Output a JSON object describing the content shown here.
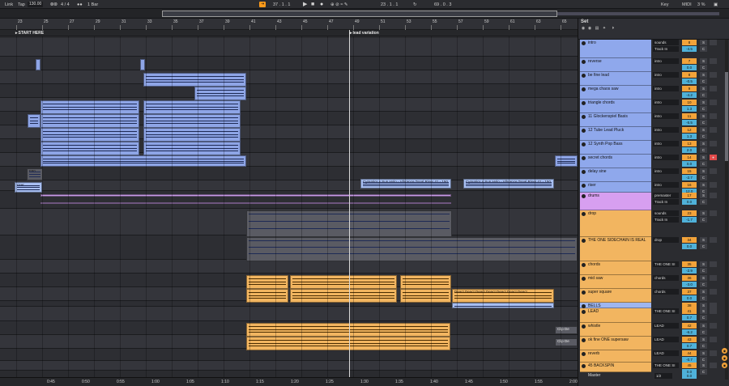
{
  "transport": {
    "link": "Link",
    "tap": "Tap",
    "bpm": "130.00",
    "signature": "4 / 4",
    "metro": "⦾⦾",
    "quantize": "1 Bar",
    "follow": "⇥",
    "position": "37 . 1 . 1",
    "loop_start": "23 . 1 . 1",
    "loop_length": "69 . 0 . 3",
    "key": "Key",
    "midi": "MIDI",
    "cpu": "3 %"
  },
  "ruler": {
    "bars": [
      "23",
      "25",
      "27",
      "29",
      "31",
      "33",
      "35",
      "37",
      "39",
      "41",
      "43",
      "45",
      "47",
      "49",
      "51",
      "53",
      "55",
      "57",
      "59",
      "61",
      "63",
      "65",
      "67"
    ],
    "locators": [
      "START HERE",
      "lead variation"
    ]
  },
  "time": [
    "0:45",
    "0:50",
    "0:55",
    "1:00",
    "1:05",
    "1:10",
    "1:15",
    "1:20",
    "1:25",
    "1:30",
    "1:35",
    "1:40",
    "1:45",
    "1:50",
    "1:55",
    "2:00"
  ],
  "clips": {
    "riser_clip": "riser",
    "f80_clip": "F80 ",
    "cymatics_1": "Cymatics x Sun Holo - Vibrance Tonal Riser 41 - 150",
    "cymatics_2": "Cymatics x Sun Holo - Vibrance Tonal Riser 41 - 150",
    "deactivate_text": "Deact Deact Deact Deact Deact Deact Deact",
    "clip_de_1": "Clip De",
    "clip_de_2": "Clip De"
  },
  "panel": {
    "set": "Set",
    "tracks": [
      {
        "name": "intro",
        "io": "sounds",
        "io2": "Track In",
        "num": "8",
        "vol": "-4.5",
        "s": "S",
        "c": "C",
        "arm": "",
        "color": "#8fa8ec"
      },
      {
        "name": "reverse",
        "io": "intro",
        "io2": "",
        "num": "7",
        "vol": "0.0",
        "s": "S",
        "c": "C",
        "arm": "",
        "color": "#8fa8ec"
      },
      {
        "name": "be fine lead",
        "io": "intro",
        "io2": "",
        "num": "8",
        "vol": "-0.5",
        "s": "S",
        "c": "C",
        "arm": "",
        "color": "#8fa8ec"
      },
      {
        "name": "mega chaos saw",
        "io": "intro",
        "io2": "",
        "num": "9",
        "vol": "-4.2",
        "s": "S",
        "c": "C",
        "arm": "",
        "color": "#8fa8ec"
      },
      {
        "name": "triangle chords",
        "io": "intro",
        "io2": "",
        "num": "10",
        "vol": "1.3",
        "s": "S",
        "c": "C",
        "arm": "",
        "color": "#8fa8ec"
      },
      {
        "name": "11 Glockenspiel Basis",
        "io": "intro",
        "io2": "",
        "num": "11",
        "vol": "-5.5",
        "s": "S",
        "c": "C",
        "arm": "",
        "color": "#8fa8ec"
      },
      {
        "name": "12 Tube Lead Pluck",
        "io": "intro",
        "io2": "",
        "num": "12",
        "vol": "1.3",
        "s": "S",
        "c": "C",
        "arm": "",
        "color": "#8fa8ec"
      },
      {
        "name": "12 Synth Pop Bass",
        "io": "intro",
        "io2": "",
        "num": "13",
        "vol": "2.0",
        "s": "S",
        "c": "C",
        "arm": "",
        "color": "#8fa8ec"
      },
      {
        "name": "secret chords",
        "io": "intro",
        "io2": "",
        "num": "14",
        "vol": "0.0",
        "s": "S",
        "c": "C",
        "arm": "●",
        "color": "#8fa8ec"
      },
      {
        "name": "delay sine",
        "io": "intro",
        "io2": "",
        "num": "15",
        "vol": "-2.7",
        "s": "S",
        "c": "C",
        "arm": "",
        "color": "#8fa8ec"
      },
      {
        "name": "riser",
        "io": "intro",
        "io2": "",
        "num": "16",
        "vol": "12.0",
        "s": "S",
        "c": "C",
        "arm": "",
        "color": "#8fa8ec"
      },
      {
        "name": "drums",
        "io": "premaster",
        "io2": "Track In",
        "num": "17",
        "vol": "0.0",
        "s": "S",
        "c": "C",
        "arm": "",
        "color": "#d79ff0"
      },
      {
        "name": "drop",
        "io": "sounds",
        "io2": "Track In",
        "num": "23",
        "vol": "-1.7",
        "s": "S",
        "c": "C",
        "arm": "",
        "color": "#f2b560"
      },
      {
        "name": "THE ONE SIDECHAIN IS REAL",
        "io": "drop",
        "io2": "",
        "num": "34",
        "vol": "0.0",
        "s": "S",
        "c": "C",
        "arm": "",
        "color": "#f2b560"
      },
      {
        "name": "chords",
        "io": "THE ONE SI",
        "io2": "",
        "num": "35",
        "vol": "-2.9",
        "s": "S",
        "c": "C",
        "arm": "",
        "color": "#f2b560"
      },
      {
        "name": "mid saw",
        "io": "chords",
        "io2": "",
        "num": "36",
        "vol": "-3.0",
        "s": "S",
        "c": "C",
        "arm": "",
        "color": "#f2b560"
      },
      {
        "name": "super square",
        "io": "chords",
        "io2": "",
        "num": "37",
        "vol": "0.0",
        "s": "S",
        "c": "C",
        "arm": "",
        "color": "#f2b560"
      },
      {
        "name": "BELLS",
        "io": "",
        "io2": "",
        "num": "38",
        "vol": "",
        "s": "S",
        "c": "",
        "arm": "",
        "color": "#9fb6f0"
      },
      {
        "name": "LEAD",
        "io": "THE ONE SI",
        "io2": "",
        "num": "41",
        "vol": "0.7",
        "s": "S",
        "c": "C",
        "arm": "",
        "color": "#f2b560"
      },
      {
        "name": "whistle",
        "io": "LEAD",
        "io2": "",
        "num": "42",
        "vol": "-6.2",
        "s": "S",
        "c": "C",
        "arm": "",
        "color": "#f2b560"
      },
      {
        "name": "ok fine ONE supersaw",
        "io": "LEAD",
        "io2": "",
        "num": "43",
        "vol": "0.7",
        "s": "S",
        "c": "C",
        "arm": "",
        "color": "#f2b560"
      },
      {
        "name": "reverb",
        "io": "LEAD",
        "io2": "",
        "num": "44",
        "vol": "-0.7",
        "s": "S",
        "c": "C",
        "arm": "",
        "color": "#f2b560"
      },
      {
        "name": "45 BACKSPIN",
        "io": "THE ONE SI",
        "io2": "",
        "num": "45",
        "vol": "0.0",
        "s": "S",
        "c": "C",
        "arm": "",
        "color": "#f2b560"
      }
    ],
    "master": {
      "name": "Master",
      "io": "1/2",
      "vol": "0.0"
    }
  }
}
